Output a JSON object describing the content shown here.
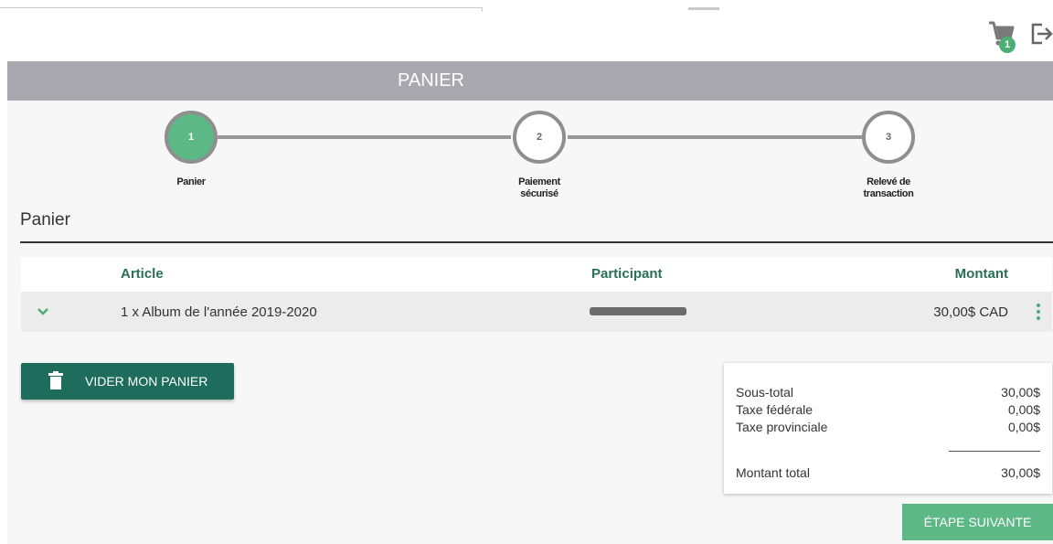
{
  "header": {
    "cart_count": "1"
  },
  "banner": {
    "title": "PANIER"
  },
  "steps": [
    {
      "number": "1",
      "label": "Panier"
    },
    {
      "number": "2",
      "label": "Paiement\nsécurisé"
    },
    {
      "number": "3",
      "label": "Relevé de\ntransaction"
    }
  ],
  "section": {
    "title": "Panier"
  },
  "table": {
    "headers": {
      "article": "Article",
      "participant": "Participant",
      "amount": "Montant"
    },
    "rows": [
      {
        "article": "1 x Album de l'année 2019-2020",
        "amount": "30,00$ CAD"
      }
    ]
  },
  "actions": {
    "empty_cart": "VIDER MON PANIER",
    "next_step": "ÉTAPE SUIVANTE"
  },
  "summary": {
    "subtotal_label": "Sous-total",
    "subtotal": "30,00$",
    "federal_label": "Taxe fédérale",
    "federal": "0,00$",
    "provincial_label": "Taxe provinciale",
    "provincial": "0,00$",
    "total_label": "Montant total",
    "total": "30,00$"
  },
  "colors": {
    "accent_dark": "#1e6c5c",
    "accent_light": "#5cb884",
    "banner": "#a8a8ae"
  }
}
